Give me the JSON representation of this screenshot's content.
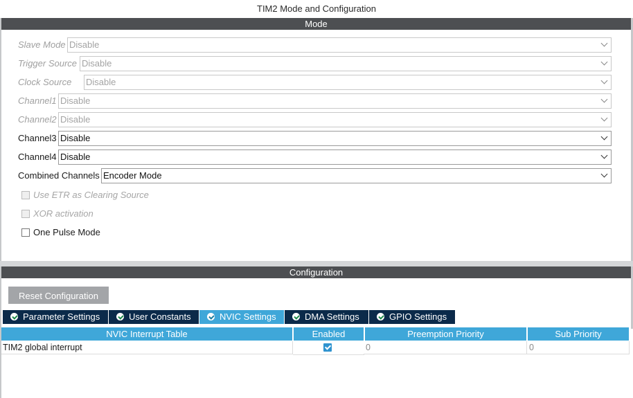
{
  "window": {
    "title": "TIM2 Mode and Configuration"
  },
  "mode": {
    "header": "Mode",
    "fields": [
      {
        "label": "Slave Mode",
        "value": "Disable",
        "enabled": false
      },
      {
        "label": "Trigger Source",
        "value": "Disable",
        "enabled": false
      },
      {
        "label": "Clock Source",
        "value": "Disable",
        "enabled": false
      },
      {
        "label": "Channel1",
        "value": "Disable",
        "enabled": false
      },
      {
        "label": "Channel2",
        "value": "Disable",
        "enabled": false
      },
      {
        "label": "Channel3",
        "value": "Disable",
        "enabled": true
      },
      {
        "label": "Channel4",
        "value": "Disable",
        "enabled": true
      },
      {
        "label": "Combined Channels",
        "value": "Encoder Mode",
        "enabled": true
      }
    ],
    "checkboxes": [
      {
        "label": "Use ETR as Clearing Source",
        "checked": false,
        "enabled": false
      },
      {
        "label": "XOR activation",
        "checked": false,
        "enabled": false
      },
      {
        "label": "One Pulse Mode",
        "checked": false,
        "enabled": true
      }
    ]
  },
  "configuration": {
    "header": "Configuration",
    "reset_label": "Reset Configuration",
    "tabs": [
      {
        "label": "Parameter Settings",
        "active": false
      },
      {
        "label": "User Constants",
        "active": false
      },
      {
        "label": "NVIC Settings",
        "active": true
      },
      {
        "label": "DMA Settings",
        "active": false
      },
      {
        "label": "GPIO Settings",
        "active": false
      }
    ],
    "nvic": {
      "columns": [
        "NVIC Interrupt Table",
        "Enabled",
        "Preemption Priority",
        "Sub Priority"
      ],
      "rows": [
        {
          "name": "TIM2 global interrupt",
          "enabled": true,
          "preemption": "0",
          "sub": "0"
        }
      ]
    }
  },
  "colors": {
    "section_bar": "#4d4f52",
    "tab_inactive": "#0b2a4a",
    "tab_active": "#3fa7d9",
    "check_green": "#1d8a4a"
  }
}
